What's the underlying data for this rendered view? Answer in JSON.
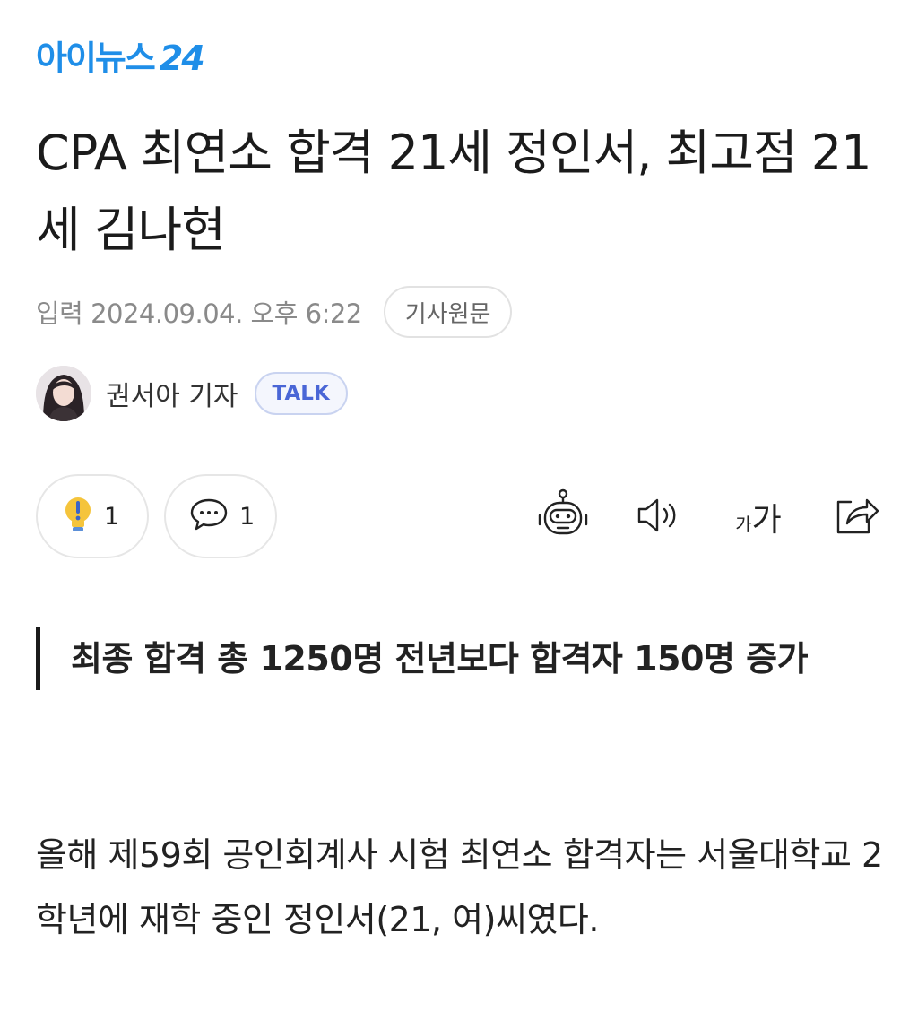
{
  "logo": {
    "text": "아이뉴스",
    "number": "24",
    "color": "#1f8ee8"
  },
  "article": {
    "headline": "CPA 최연소 합격 21세 정인서, 최고점 21세 김나현",
    "date": "입력 2024.09.04. 오후 6:22",
    "original_label": "기사원문",
    "author": "권서아 기자",
    "talk_label": "TALK",
    "subtitle": "최종 합격 총 1250명 전년보다 합격자 150명 증가",
    "body": "올해 제59회 공인회계사 시험 최연소 합격자는 서울대학교 2학년에 재학 중인 정인서(21, 여)씨였다."
  },
  "reactions": {
    "like_count": "1",
    "comment_count": "1"
  },
  "toolbar": {
    "icons": [
      "robot-summary-icon",
      "speaker-icon",
      "font-size-icon",
      "share-icon"
    ],
    "font_small": "가",
    "font_large": "가"
  },
  "colors": {
    "accent": "#1f8ee8",
    "talk": "#4a66d6",
    "bulb": "#f5c43b"
  }
}
